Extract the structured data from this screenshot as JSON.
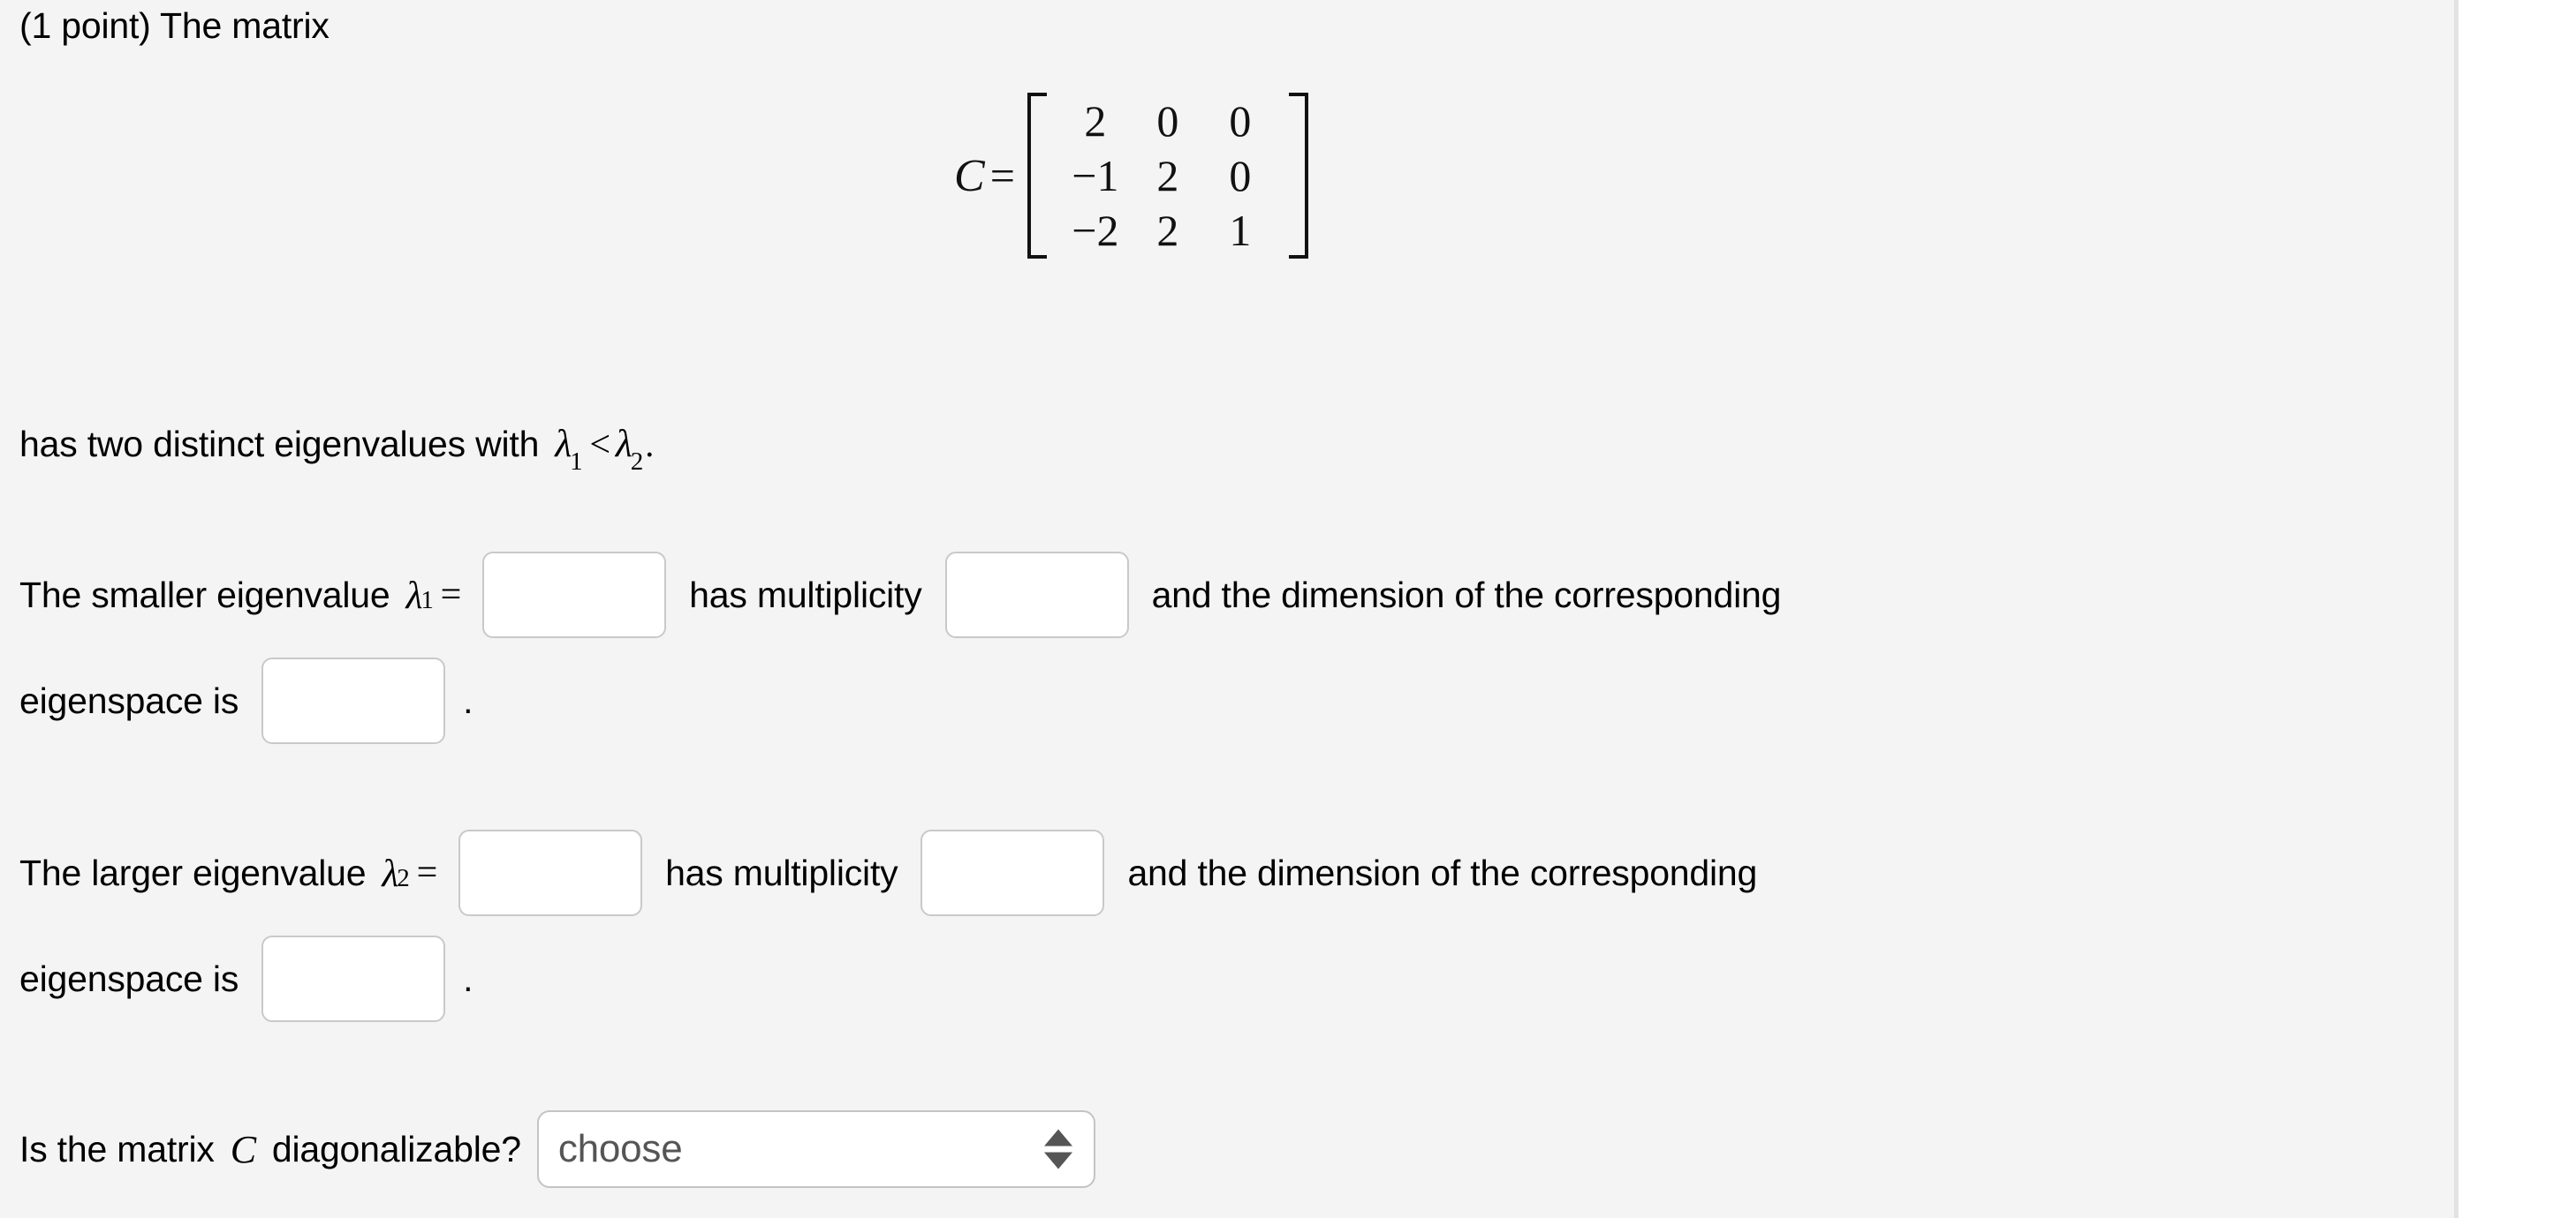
{
  "problem": {
    "points_label": "(1 point) The matrix",
    "matrix": {
      "name": "C",
      "equals": "=",
      "rows": [
        [
          "2",
          "0",
          "0"
        ],
        [
          "−1",
          "2",
          "0"
        ],
        [
          "−2",
          "2",
          "1"
        ]
      ]
    },
    "eigen_statement": {
      "text_before": "has two distinct eigenvalues with",
      "lambda": "λ",
      "sub1": "1",
      "relation": "<",
      "sub2": "2",
      "period": "."
    },
    "smaller_eigenvalue_row": {
      "text_before": "The smaller eigenvalue",
      "lambda": "λ",
      "subscript": "1",
      "equals": "=",
      "value_placeholder": "",
      "text_middle": "has multiplicity",
      "multiplicity_placeholder": "",
      "text_after": "and the dimension of the corresponding"
    },
    "smaller_eigenspace_row": {
      "text_before": "eigenspace is",
      "dimension_placeholder": "",
      "period": "."
    },
    "larger_eigenvalue_row": {
      "text_before": "The larger eigenvalue",
      "lambda": "λ",
      "subscript": "2",
      "equals": "=",
      "value_placeholder": "",
      "text_middle": "has multiplicity",
      "multiplicity_placeholder": "",
      "text_after": "and the dimension of the corresponding"
    },
    "larger_eigenspace_row": {
      "text_before": "eigenspace is",
      "dimension_placeholder": "",
      "period": "."
    },
    "diagonalizable_row": {
      "text_before": "Is the matrix",
      "matrix_name": "C",
      "text_after": "diagonalizable?",
      "select_value": "choose"
    }
  },
  "colors": {
    "panel_background": "#f4f4f4",
    "page_background": "#ffffff",
    "text": "#000000",
    "input_border": "#c9c9c9",
    "input_background": "#ffffff",
    "select_text": "#555555",
    "arrow": "#555555",
    "divider": "#e3e3e3"
  }
}
